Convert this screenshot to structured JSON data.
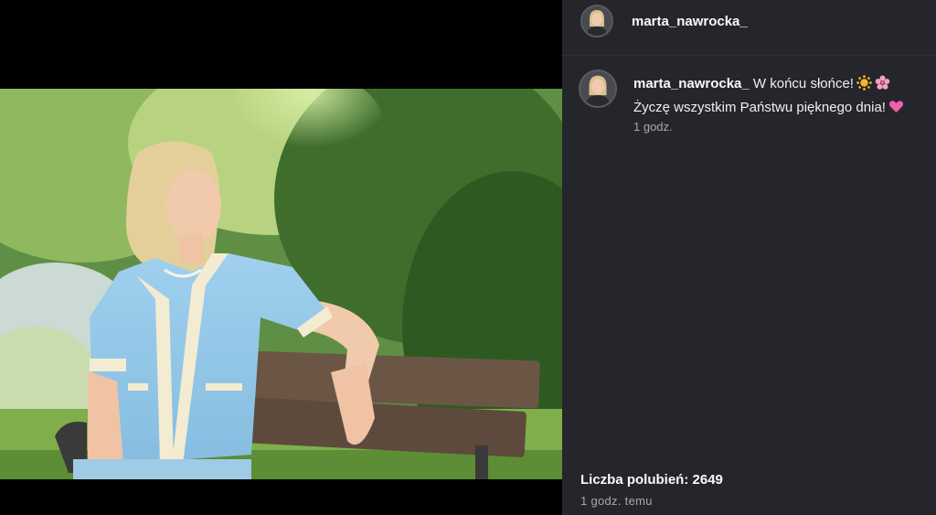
{
  "header": {
    "username": "marta_nawrocka_"
  },
  "comment": {
    "username": "marta_nawrocka_",
    "line1": "W końcu słońce!",
    "line1_emojis": [
      "sun-emoji",
      "cherry-blossom-emoji"
    ],
    "line2": "Życzę wszystkim Państwu pięknego dnia!",
    "line2_emojis": [
      "pink-heart-emoji"
    ],
    "time": "1 godz."
  },
  "footer": {
    "likes_label": "Liczba polubień:",
    "likes_count": "2649",
    "posted": "1 godz. temu"
  },
  "colors": {
    "panel_bg": "#25262b",
    "media_bg": "#000000",
    "text_primary": "#fafafa",
    "text_secondary": "#a8a8a8"
  }
}
